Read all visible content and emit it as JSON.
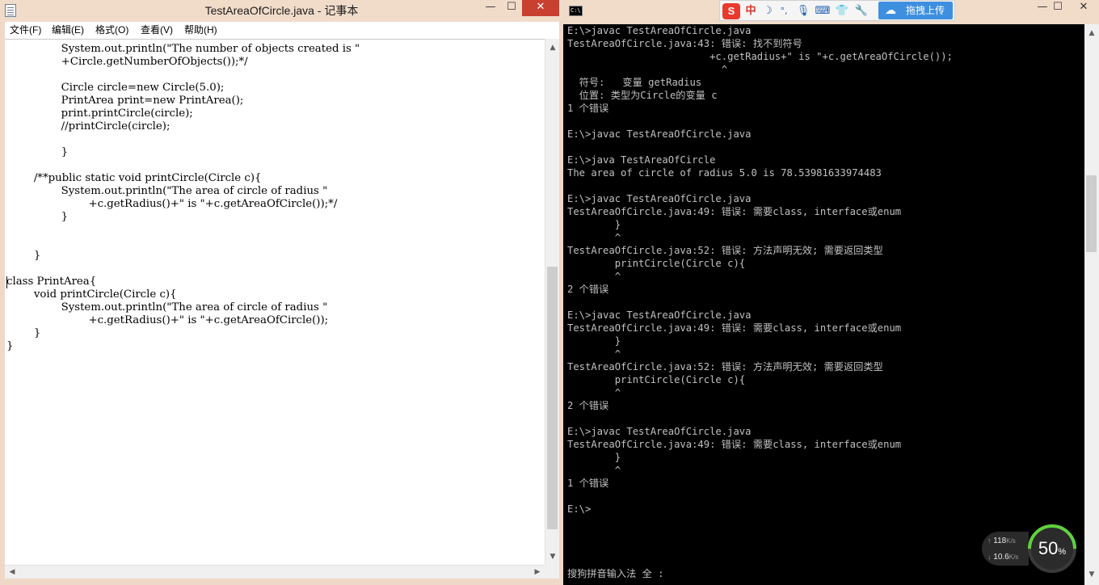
{
  "notepad": {
    "title": "TestAreaOfCircle.java - 记事本",
    "menu": [
      "文件(F)",
      "编辑(E)",
      "格式(O)",
      "查看(V)",
      "帮助(H)"
    ],
    "lines": [
      "                System.out.println(\"The number of objects created is \"",
      "                +Circle.getNumberOfObjects());*/",
      "",
      "                Circle circle=new Circle(5.0);",
      "                PrintArea print=new PrintArea();",
      "                print.printCircle(circle);",
      "                //printCircle(circle);",
      "",
      "                }",
      "",
      "        /**public static void printCircle(Circle c){",
      "                System.out.println(\"The area of circle of radius \"",
      "                        +c.getRadius()+\" is \"+c.getAreaOfCircle());*/",
      "                }",
      "",
      "",
      "",
      "        }",
      "",
      "class PrintArea{",
      "        void printCircle(Circle c){",
      "                System.out.println(\"The area of circle of radius \"",
      "                        +c.getRadius()+\" is \"+c.getAreaOfCircle());",
      "        }",
      "}"
    ]
  },
  "console": {
    "ime": {
      "logo": "S",
      "mode": "中",
      "moon": "☽",
      "punct": "°,",
      "upload_label": "拖拽上传"
    },
    "lines": [
      "E:\\>javac TestAreaOfCircle.java",
      "TestAreaOfCircle.java:43: 错误: 找不到符号",
      "                        +c.getRadius+\" is \"+c.getAreaOfCircle());",
      "                          ^",
      "  符号:   变量 getRadius",
      "  位置: 类型为Circle的变量 c",
      "1 个错误",
      "",
      "E:\\>javac TestAreaOfCircle.java",
      "",
      "E:\\>java TestAreaOfCircle",
      "The area of circle of radius 5.0 is 78.53981633974483",
      "",
      "E:\\>javac TestAreaOfCircle.java",
      "TestAreaOfCircle.java:49: 错误: 需要class, interface或enum",
      "        }",
      "        ^",
      "TestAreaOfCircle.java:52: 错误: 方法声明无效; 需要返回类型",
      "        printCircle(Circle c){",
      "        ^",
      "2 个错误",
      "",
      "E:\\>javac TestAreaOfCircle.java",
      "TestAreaOfCircle.java:49: 错误: 需要class, interface或enum",
      "        }",
      "        ^",
      "TestAreaOfCircle.java:52: 错误: 方法声明无效; 需要返回类型",
      "        printCircle(Circle c){",
      "        ^",
      "2 个错误",
      "",
      "E:\\>javac TestAreaOfCircle.java",
      "TestAreaOfCircle.java:49: 错误: 需要class, interface或enum",
      "        }",
      "        ^",
      "1 个错误",
      "",
      "E:\\>",
      "",
      "",
      "",
      "",
      "搜狗拼音输入法 全 :"
    ]
  },
  "network": {
    "upload": "118",
    "upload_unit": "K/s",
    "download": "10.6",
    "download_unit": "K/s"
  },
  "cpu": {
    "value": "50",
    "unit": "%"
  }
}
